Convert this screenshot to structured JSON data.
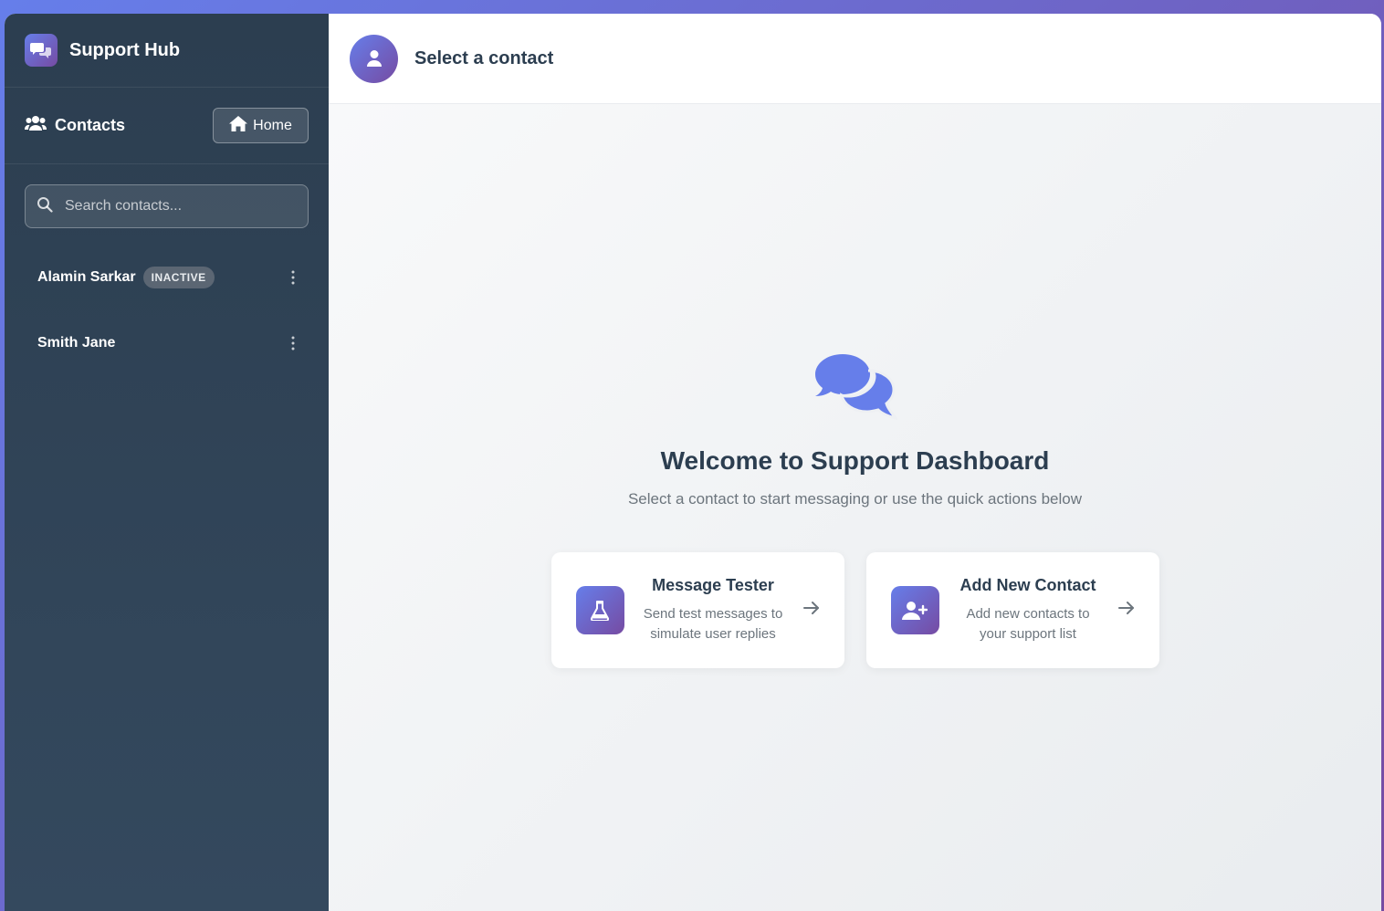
{
  "sidebar": {
    "brand_title": "Support Hub",
    "contacts_heading": "Contacts",
    "home_button": "Home",
    "search": {
      "placeholder": "Search contacts..."
    },
    "contacts": [
      {
        "name": "Alamin Sarkar",
        "badge": "INACTIVE"
      },
      {
        "name": "Smith Jane",
        "badge": ""
      }
    ]
  },
  "main": {
    "header_title": "Select a contact",
    "welcome_title": "Welcome to Support Dashboard",
    "welcome_subtitle": "Select a contact to start messaging or use the quick actions below",
    "actions": [
      {
        "title": "Message Tester",
        "desc_line1": "Send test messages to",
        "desc_line2": "simulate user replies",
        "icon": "flask-icon"
      },
      {
        "title": "Add New Contact",
        "desc_line1": "Add new contacts to",
        "desc_line2": "your support list",
        "icon": "user-plus-icon"
      }
    ]
  },
  "colors": {
    "accent_start": "#667eea",
    "accent_end": "#764ba2",
    "sidebar_bg": "#2c3e50",
    "text_dark": "#2c3e50",
    "text_muted": "#6c757d"
  }
}
